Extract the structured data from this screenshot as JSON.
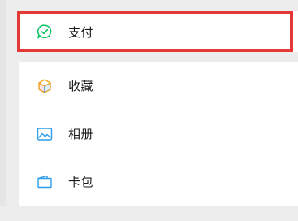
{
  "menu": {
    "pay": {
      "label": "支付",
      "icon": "wechat-pay-icon",
      "color": "#07c160"
    },
    "items": [
      {
        "label": "收藏",
        "icon": "favorites-cube-icon"
      },
      {
        "label": "相册",
        "icon": "album-icon"
      },
      {
        "label": "卡包",
        "icon": "card-wallet-icon"
      }
    ]
  },
  "highlight": {
    "color": "#e53935"
  }
}
